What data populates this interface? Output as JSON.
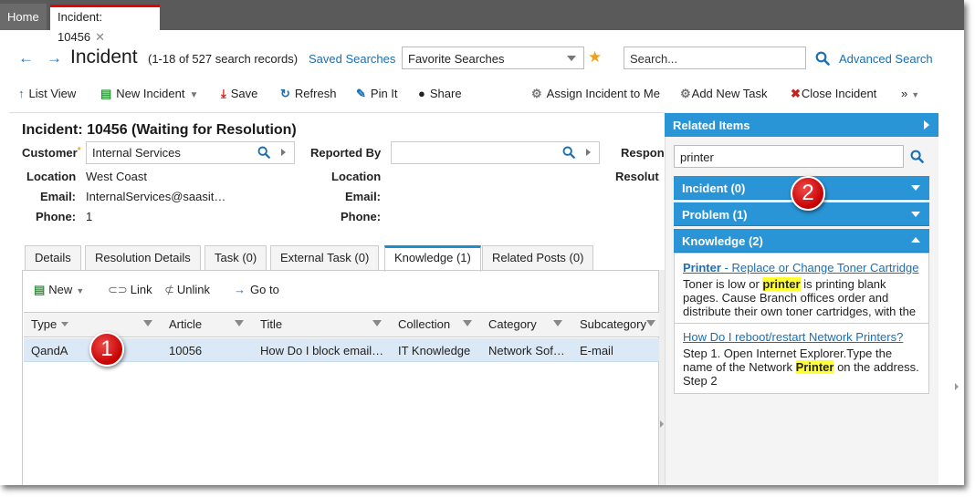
{
  "top_tabs": {
    "home": "Home",
    "active": "Incident: 10456",
    "close_glyph": "✕"
  },
  "header": {
    "back_glyph": "←",
    "forward_glyph": "→",
    "title": "Incident",
    "records": "(1-18 of 527 search records)",
    "saved_searches": "Saved Searches",
    "favorite_select": "Favorite Searches",
    "star_glyph": "★",
    "search_placeholder": "Search...",
    "advanced_search": "Advanced Search"
  },
  "toolbar": {
    "list_view": "List View",
    "new_incident": "New Incident",
    "save": "Save",
    "refresh": "Refresh",
    "pin_it": "Pin It",
    "share": "Share",
    "assign": "Assign Incident to Me",
    "add_task": "Add New Task",
    "close_incident": "Close Incident",
    "more": "»"
  },
  "form": {
    "title": "Incident: 10456 (Waiting for Resolution)",
    "customer_label": "Customer",
    "customer_value": "Internal Services",
    "reported_by_label": "Reported By",
    "reported_by_value": "",
    "respon_label": "Respon",
    "resolut_label": "Resolut",
    "location_label": "Location",
    "location_value": "West Coast",
    "email_label": "Email:",
    "email_value": "InternalServices@saasit…",
    "phone_label": "Phone:",
    "phone_value": "1",
    "location2_label": "Location",
    "email2_label": "Email:",
    "phone2_label": "Phone:"
  },
  "subtabs": [
    "Details",
    "Resolution Details",
    "Task (0)",
    "External Task (0)",
    "Knowledge (1)",
    "Related Posts (0)"
  ],
  "grid_toolbar": {
    "new": "New",
    "link": "Link",
    "unlink": "Unlink",
    "goto": "Go to"
  },
  "grid": {
    "columns": [
      "Type",
      "Article",
      "Title",
      "Collection",
      "Category",
      "Subcategory"
    ],
    "rows": [
      {
        "type": "QandA",
        "article": "10056",
        "title": "How Do I block email…",
        "collection": "IT Knowledge",
        "category": "Network Sof…",
        "subcategory": "E-mail"
      }
    ]
  },
  "callouts": [
    "1",
    "2"
  ],
  "related": {
    "header": "Related Items",
    "search_value": "printer",
    "incident": "Incident (0)",
    "problem": "Problem (1)",
    "knowledge": "Knowledge (2)",
    "k1_title_bold": "Printer",
    "k1_title_rest": " - Replace or Change Toner Cartridge",
    "k1_body_a": "Toner is low or ",
    "k1_body_hl": "printer",
    "k1_body_b": " is printing blank pages. Cause Branch offices order and distribute their own toner cartridges, with the",
    "k2_title": "How Do I reboot/restart Network Printers?",
    "k2_body_a": "Step 1. Open Internet Explorer.Type the name of the Network ",
    "k2_body_hl": "Printer",
    "k2_body_b": " on the address. Step 2"
  },
  "colors": {
    "accent": "#2a95d6",
    "link": "#1a6fb5",
    "active_tab_border": "#e00000",
    "row_highlight": "#dbe9f6",
    "highlight": "#ffff33"
  }
}
